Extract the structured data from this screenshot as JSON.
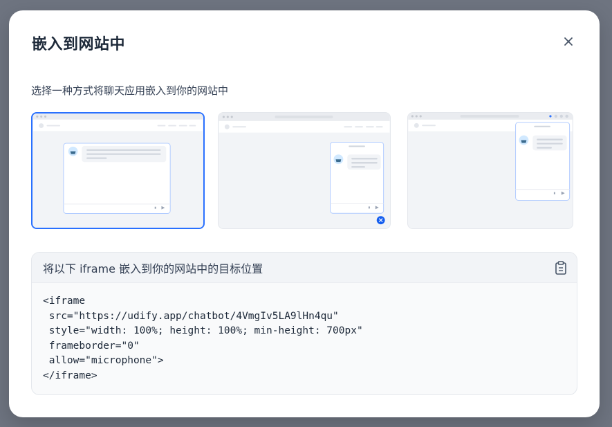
{
  "modal": {
    "title": "嵌入到网站中",
    "subtitle": "选择一种方式将聊天应用嵌入到你的网站中",
    "close_icon": "close-icon"
  },
  "options": [
    {
      "name": "fullscreen",
      "selected": true
    },
    {
      "name": "floating-bubble",
      "selected": false
    },
    {
      "name": "chrome-extension",
      "selected": false
    }
  ],
  "code": {
    "header": "将以下 iframe 嵌入到你的网站中的目标位置",
    "copy_icon": "clipboard-icon",
    "lines": [
      "<iframe",
      " src=\"https://udify.app/chatbot/4VmgIv5LA9lHn4qu\"",
      " style=\"width: 100%; height: 100%; min-height: 700px\"",
      " frameborder=\"0\"",
      " allow=\"microphone\">",
      "</iframe>"
    ]
  },
  "colors": {
    "accent": "#2970ff",
    "overlay": "#6e7480",
    "text": "#1d2939"
  }
}
